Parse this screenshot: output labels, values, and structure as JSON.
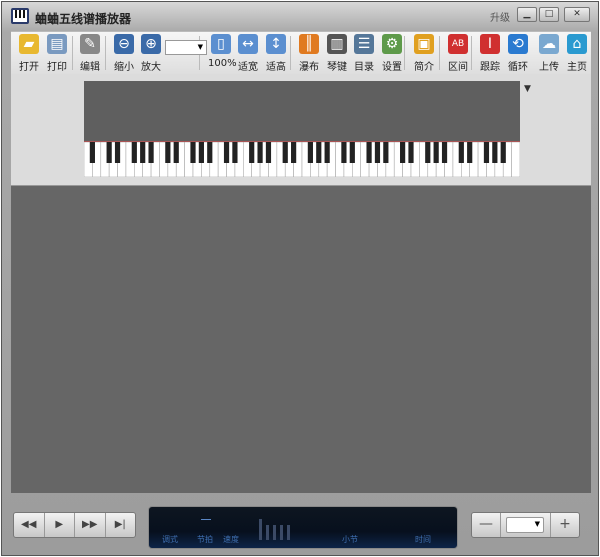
{
  "window": {
    "title": "蛐蛐五线谱播放器",
    "upgrade": "升级",
    "minimize": "▁",
    "maximize": "□",
    "close": "✕"
  },
  "toolbar": [
    {
      "id": "open",
      "label": "打开",
      "icon": "folder-open-icon",
      "color": "#e8b830"
    },
    {
      "id": "print",
      "label": "打印",
      "icon": "printer-icon",
      "color": "#7a9ac0"
    },
    {
      "id": "edit",
      "label": "编辑",
      "icon": "edit-score-icon",
      "color": "#888888"
    },
    {
      "id": "zoom-out",
      "label": "缩小",
      "icon": "zoom-out-icon",
      "color": "#3a6aa8"
    },
    {
      "id": "zoom-in",
      "label": "放大",
      "icon": "zoom-in-icon",
      "color": "#3a6aa8"
    },
    {
      "id": "zoom-100",
      "label": "100%",
      "icon": "page-100-icon",
      "color": "#5b8fd0"
    },
    {
      "id": "fit-width",
      "label": "适宽",
      "icon": "fit-width-icon",
      "color": "#5b8fd0"
    },
    {
      "id": "fit-height",
      "label": "适高",
      "icon": "fit-height-icon",
      "color": "#5b8fd0"
    },
    {
      "id": "waterfall",
      "label": "瀑布",
      "icon": "waterfall-icon",
      "color": "#e07a20"
    },
    {
      "id": "keyboard",
      "label": "琴键",
      "icon": "keyboard-icon",
      "color": "#555555"
    },
    {
      "id": "catalog",
      "label": "目录",
      "icon": "catalog-icon",
      "color": "#557799"
    },
    {
      "id": "settings",
      "label": "设置",
      "icon": "gear-icon",
      "color": "#5e9a4a"
    },
    {
      "id": "intro",
      "label": "简介",
      "icon": "clipboard-icon",
      "color": "#e0a020"
    },
    {
      "id": "range",
      "label": "区间",
      "icon": "ab-repeat-icon",
      "color": "#d03030"
    },
    {
      "id": "follow",
      "label": "跟踪",
      "icon": "follow-icon",
      "color": "#d03030"
    },
    {
      "id": "loop",
      "label": "循环",
      "icon": "loop-icon",
      "color": "#2a7ad0"
    },
    {
      "id": "upload",
      "label": "上传",
      "icon": "cloud-upload-icon",
      "color": "#7aa8d0"
    },
    {
      "id": "home",
      "label": "主页",
      "icon": "home-icon",
      "color": "#2a9ad0"
    }
  ],
  "zoom_select": {
    "value": ""
  },
  "transport": [
    {
      "id": "rewind",
      "glyph": "◀◀"
    },
    {
      "id": "play",
      "glyph": "▶"
    },
    {
      "id": "forward",
      "glyph": "▶▶"
    },
    {
      "id": "end",
      "glyph": "▶|"
    }
  ],
  "display": {
    "mode": "调式",
    "beat": "节拍",
    "tempo": "速度",
    "measure": "小节",
    "time": "时间"
  },
  "volume": {
    "minus": "—",
    "plus": "+",
    "value": ""
  }
}
